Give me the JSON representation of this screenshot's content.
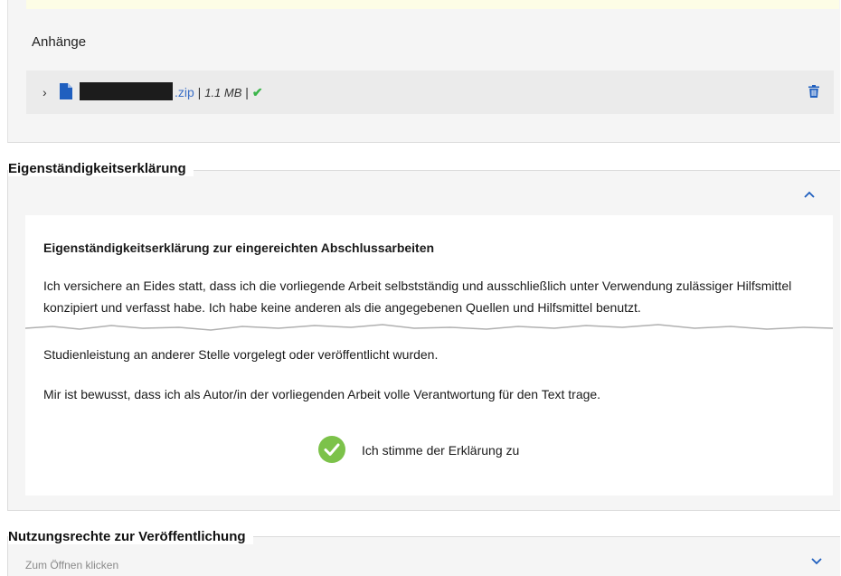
{
  "attachments": {
    "title": "Anhänge",
    "file": {
      "extension": ".zip",
      "separator1": " | ",
      "size": "1.1 MB",
      "separator2": " | ",
      "status_check": "✔"
    }
  },
  "declaration": {
    "section_title": "Eigenständigkeitserklärung",
    "heading": "Eigenständigkeitserklärung zur eingereichten Abschlussarbeiten",
    "paragraph1": "Ich versichere an Eides statt, dass ich die vorliegende Arbeit selbstständig und ausschließlich unter Verwendung zulässiger Hilfsmittel konzipiert und verfasst habe. Ich habe keine anderen als die angegebenen Quellen und Hilfsmittel benutzt.",
    "paragraph2": "Studienleistung an anderer Stelle vorgelegt oder veröffentlicht wurden.",
    "paragraph3": "Mir ist bewusst, dass ich als Autor/in der vorliegenden Arbeit volle Verantwortung für den Text trage.",
    "agree_label": "Ich stimme der Erklärung zu",
    "agreed": true
  },
  "usage_rights": {
    "section_title": "Nutzungsrechte zur Veröffentlichung",
    "hint": "Zum Öffnen klicken"
  },
  "colors": {
    "accent_blue": "#1f5fbf",
    "check_green": "#3bb54a",
    "agree_green": "#7cc24a"
  }
}
